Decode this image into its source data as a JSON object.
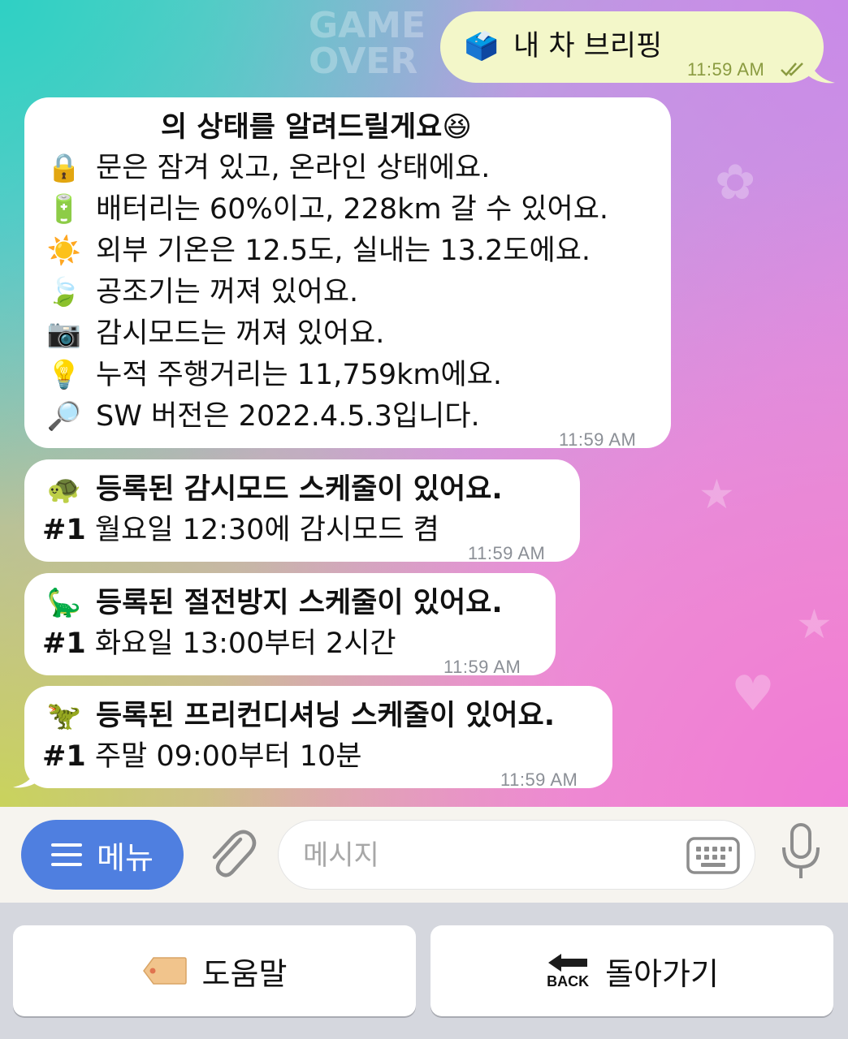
{
  "chat": {
    "outgoing": {
      "emoji": "🗳️",
      "text": "내 차 브리핑",
      "time": "11:59 AM"
    },
    "status_message": {
      "title": "의 상태를 알려드릴게요😆",
      "lines": [
        {
          "icon": "lock-icon",
          "emoji": "🔒",
          "text": "문은 잠겨 있고, 온라인 상태에요."
        },
        {
          "icon": "battery-icon",
          "emoji": "🔋",
          "text": "배터리는 60%이고, 228km 갈 수 있어요."
        },
        {
          "icon": "sun-icon",
          "emoji": "☀️",
          "text": "외부 기온은 12.5도, 실내는 13.2도에요."
        },
        {
          "icon": "leaf-icon",
          "emoji": "🍃",
          "text": "공조기는 꺼져 있어요."
        },
        {
          "icon": "camera-icon",
          "emoji": "📷",
          "text": "감시모드는 꺼져 있어요."
        },
        {
          "icon": "lightbulb-icon",
          "emoji": "💡",
          "text": "누적 주행거리는 11,759km에요."
        },
        {
          "icon": "magnifier-icon",
          "emoji": "🔎",
          "text": "SW 버전은 2022.4.5.3입니다."
        }
      ],
      "time": "11:59 AM"
    },
    "schedules": [
      {
        "icon": "turtle-icon",
        "emoji": "🐢",
        "title": "등록된 감시모드 스케줄이 있어요.",
        "num": "#1",
        "detail": "월요일 12:30에 감시모드 켬",
        "time": "11:59 AM"
      },
      {
        "icon": "sauropod-icon",
        "emoji": "🦕",
        "title": "등록된 절전방지 스케줄이 있어요.",
        "num": "#1",
        "detail": "화요일 13:00부터 2시간",
        "time": "11:59 AM"
      },
      {
        "icon": "t-rex-icon",
        "emoji": "🦖",
        "title": "등록된 프리컨디셔닝 스케줄이 있어요.",
        "num": "#1",
        "detail": "주말 09:00부터 10분",
        "time": "11:59 AM"
      }
    ]
  },
  "input_bar": {
    "menu_label": "메뉴",
    "placeholder": "메시지"
  },
  "keyboard": {
    "help_label": "도움말",
    "back_label": "돌아가기",
    "back_icon_text": "BACK"
  },
  "colors": {
    "menu_button": "#4f7fe0",
    "outgoing_bubble": "#f3f7c9",
    "incoming_bubble": "#ffffff"
  }
}
